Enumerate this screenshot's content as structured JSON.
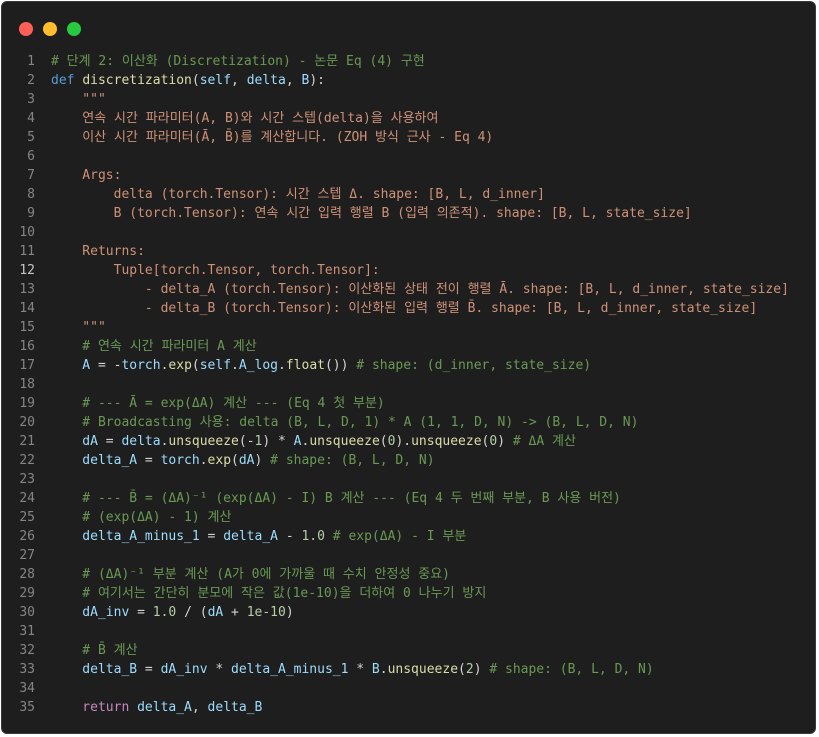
{
  "window": {
    "buttons": {
      "close_color": "#ff5f56",
      "minimize_color": "#ffbd2e",
      "maximize_color": "#27c93f"
    },
    "active_line": 12
  },
  "code": {
    "lines": [
      {
        "n": "1",
        "t": [
          [
            "cmt",
            "# 단계 2: 이산화 (Discretization) - 논문 Eq (4) 구현"
          ]
        ]
      },
      {
        "n": "2",
        "t": [
          [
            "kw",
            "def "
          ],
          [
            "fn",
            "discretization"
          ],
          [
            "op",
            "("
          ],
          [
            "var",
            "self"
          ],
          [
            "op",
            ", "
          ],
          [
            "var",
            "delta"
          ],
          [
            "op",
            ", "
          ],
          [
            "var",
            "B"
          ],
          [
            "op",
            "):"
          ]
        ]
      },
      {
        "n": "3",
        "t": [
          [
            "str",
            "    \"\"\""
          ]
        ]
      },
      {
        "n": "4",
        "t": [
          [
            "str",
            "    연속 시간 파라미터(A, B)와 시간 스텝(delta)을 사용하여"
          ]
        ]
      },
      {
        "n": "5",
        "t": [
          [
            "str",
            "    이산 시간 파라미터(Ā, B̄)를 계산합니다. (ZOH 방식 근사 - Eq 4)"
          ]
        ]
      },
      {
        "n": "6",
        "t": [
          [
            "str",
            ""
          ]
        ]
      },
      {
        "n": "7",
        "t": [
          [
            "str",
            "    Args:"
          ]
        ]
      },
      {
        "n": "8",
        "t": [
          [
            "str",
            "        delta (torch.Tensor): 시간 스텝 Δ. shape: [B, L, d_inner]"
          ]
        ]
      },
      {
        "n": "9",
        "t": [
          [
            "str",
            "        B (torch.Tensor): 연속 시간 입력 행렬 B (입력 의존적). shape: [B, L, state_size]"
          ]
        ]
      },
      {
        "n": "10",
        "t": [
          [
            "str",
            ""
          ]
        ]
      },
      {
        "n": "11",
        "t": [
          [
            "str",
            "    Returns:"
          ]
        ]
      },
      {
        "n": "12",
        "t": [
          [
            "str",
            "        Tuple[torch.Tensor, torch.Tensor]:"
          ]
        ]
      },
      {
        "n": "13",
        "t": [
          [
            "str",
            "            - delta_A (torch.Tensor): 이산화된 상태 전이 행렬 Ā. shape: [B, L, d_inner, state_size]"
          ]
        ]
      },
      {
        "n": "14",
        "t": [
          [
            "str",
            "            - delta_B (torch.Tensor): 이산화된 입력 행렬 B̄. shape: [B, L, d_inner, state_size]"
          ]
        ]
      },
      {
        "n": "15",
        "t": [
          [
            "str",
            "    \"\"\""
          ]
        ]
      },
      {
        "n": "16",
        "t": [
          [
            "cmt",
            "    # 연속 시간 파라미터 A 계산"
          ]
        ]
      },
      {
        "n": "17",
        "t": [
          [
            "var",
            "    A"
          ],
          [
            "op",
            " = -"
          ],
          [
            "var",
            "torch"
          ],
          [
            "op",
            "."
          ],
          [
            "fn",
            "exp"
          ],
          [
            "op",
            "("
          ],
          [
            "var",
            "self"
          ],
          [
            "op",
            "."
          ],
          [
            "var",
            "A_log"
          ],
          [
            "op",
            "."
          ],
          [
            "fn",
            "float"
          ],
          [
            "op",
            "()) "
          ],
          [
            "cmt",
            "# shape: (d_inner, state_size)"
          ]
        ]
      },
      {
        "n": "18",
        "t": [
          [
            "op",
            ""
          ]
        ]
      },
      {
        "n": "19",
        "t": [
          [
            "cmt",
            "    # --- Ā = exp(ΔA) 계산 --- (Eq 4 첫 부분)"
          ]
        ]
      },
      {
        "n": "20",
        "t": [
          [
            "cmt",
            "    # Broadcasting 사용: delta (B, L, D, 1) * A (1, 1, D, N) -> (B, L, D, N)"
          ]
        ]
      },
      {
        "n": "21",
        "t": [
          [
            "var",
            "    dA"
          ],
          [
            "op",
            " = "
          ],
          [
            "var",
            "delta"
          ],
          [
            "op",
            "."
          ],
          [
            "fn",
            "unsqueeze"
          ],
          [
            "op",
            "(-"
          ],
          [
            "num",
            "1"
          ],
          [
            "op",
            ") * "
          ],
          [
            "var",
            "A"
          ],
          [
            "op",
            "."
          ],
          [
            "fn",
            "unsqueeze"
          ],
          [
            "op",
            "("
          ],
          [
            "num",
            "0"
          ],
          [
            "op",
            ")."
          ],
          [
            "fn",
            "unsqueeze"
          ],
          [
            "op",
            "("
          ],
          [
            "num",
            "0"
          ],
          [
            "op",
            ") "
          ],
          [
            "cmt",
            "# ΔA 계산"
          ]
        ]
      },
      {
        "n": "22",
        "t": [
          [
            "var",
            "    delta_A"
          ],
          [
            "op",
            " = "
          ],
          [
            "var",
            "torch"
          ],
          [
            "op",
            "."
          ],
          [
            "fn",
            "exp"
          ],
          [
            "op",
            "("
          ],
          [
            "var",
            "dA"
          ],
          [
            "op",
            ") "
          ],
          [
            "cmt",
            "# shape: (B, L, D, N)"
          ]
        ]
      },
      {
        "n": "23",
        "t": [
          [
            "op",
            ""
          ]
        ]
      },
      {
        "n": "24",
        "t": [
          [
            "cmt",
            "    # --- B̄ = (ΔA)⁻¹ (exp(ΔA) - I) B 계산 --- (Eq 4 두 번째 부분, B 사용 버전)"
          ]
        ]
      },
      {
        "n": "25",
        "t": [
          [
            "cmt",
            "    # (exp(ΔA) - 1) 계산"
          ]
        ]
      },
      {
        "n": "26",
        "t": [
          [
            "var",
            "    delta_A_minus_1"
          ],
          [
            "op",
            " = "
          ],
          [
            "var",
            "delta_A"
          ],
          [
            "op",
            " - "
          ],
          [
            "num",
            "1.0"
          ],
          [
            "op",
            " "
          ],
          [
            "cmt",
            "# exp(ΔA) - I 부분"
          ]
        ]
      },
      {
        "n": "27",
        "t": [
          [
            "op",
            ""
          ]
        ]
      },
      {
        "n": "28",
        "t": [
          [
            "cmt",
            "    # (ΔA)⁻¹ 부분 계산 (A가 0에 가까울 때 수치 안정성 중요)"
          ]
        ]
      },
      {
        "n": "29",
        "t": [
          [
            "cmt",
            "    # 여기서는 간단히 분모에 작은 값(1e-10)을 더하여 0 나누기 방지"
          ]
        ]
      },
      {
        "n": "30",
        "t": [
          [
            "var",
            "    dA_inv"
          ],
          [
            "op",
            " = "
          ],
          [
            "num",
            "1.0"
          ],
          [
            "op",
            " / ("
          ],
          [
            "var",
            "dA"
          ],
          [
            "op",
            " + "
          ],
          [
            "num",
            "1e-10"
          ],
          [
            "op",
            ")"
          ]
        ]
      },
      {
        "n": "31",
        "t": [
          [
            "op",
            ""
          ]
        ]
      },
      {
        "n": "32",
        "t": [
          [
            "cmt",
            "    # B̄ 계산"
          ]
        ]
      },
      {
        "n": "33",
        "t": [
          [
            "var",
            "    delta_B"
          ],
          [
            "op",
            " = "
          ],
          [
            "var",
            "dA_inv"
          ],
          [
            "op",
            " * "
          ],
          [
            "var",
            "delta_A_minus_1"
          ],
          [
            "op",
            " * "
          ],
          [
            "var",
            "B"
          ],
          [
            "op",
            "."
          ],
          [
            "fn",
            "unsqueeze"
          ],
          [
            "op",
            "("
          ],
          [
            "num",
            "2"
          ],
          [
            "op",
            ") "
          ],
          [
            "cmt",
            "# shape: (B, L, D, N)"
          ]
        ]
      },
      {
        "n": "34",
        "t": [
          [
            "op",
            ""
          ]
        ]
      },
      {
        "n": "35",
        "t": [
          [
            "ctl",
            "    return "
          ],
          [
            "var",
            "delta_A"
          ],
          [
            "op",
            ", "
          ],
          [
            "var",
            "delta_B"
          ]
        ]
      }
    ]
  }
}
